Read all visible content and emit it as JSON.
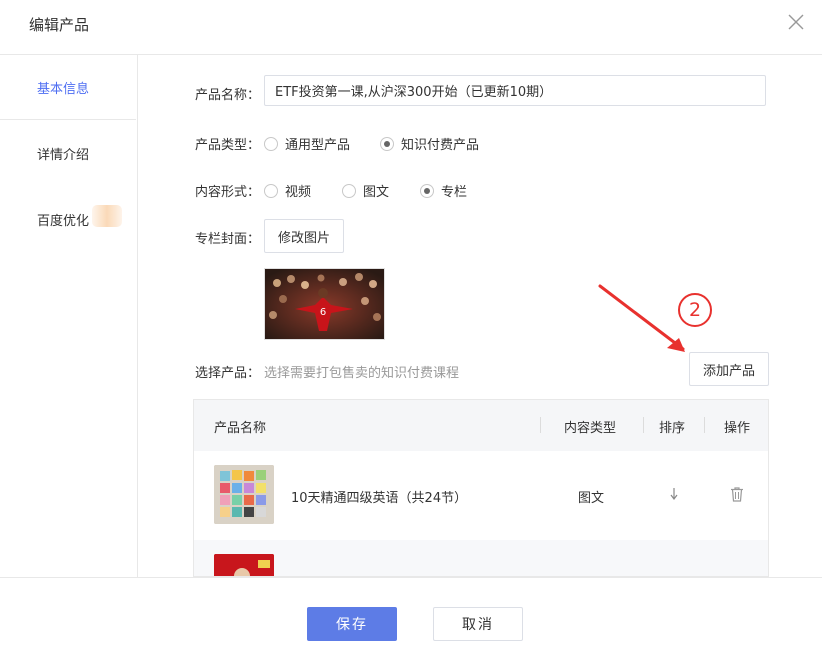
{
  "dialog": {
    "title": "编辑产品"
  },
  "sidebar": {
    "items": [
      {
        "label": "基本信息",
        "active": true
      },
      {
        "label": "详情介绍",
        "active": false
      },
      {
        "label": "百度优化",
        "active": false
      }
    ]
  },
  "form": {
    "name_label": "产品名称：",
    "name_value": "ETF投资第一课,从沪深300开始（已更新10期）",
    "type_label": "产品类型：",
    "type_options": [
      {
        "label": "通用型产品",
        "checked": false
      },
      {
        "label": "知识付费产品",
        "checked": true
      }
    ],
    "format_label": "内容形式：",
    "format_options": [
      {
        "label": "视频",
        "checked": false
      },
      {
        "label": "图文",
        "checked": false
      },
      {
        "label": "专栏",
        "checked": true
      }
    ],
    "cover_label": "专栏封面：",
    "cover_button": "修改图片",
    "select_label": "选择产品：",
    "select_hint": "选择需要打包售卖的知识付费课程",
    "add_button": "添加产品"
  },
  "table": {
    "headers": {
      "name": "产品名称",
      "type": "内容类型",
      "order": "排序",
      "action": "操作"
    },
    "rows": [
      {
        "name": "10天精通四级英语（共24节）",
        "type": "图文",
        "order_icon": "arrow-down-icon",
        "action_icon": "trash-icon"
      },
      {
        "name": "",
        "type": "",
        "order_icon": "arrow-icon",
        "action_icon": "trash-icon"
      }
    ]
  },
  "annotation": {
    "number": "2",
    "color": "#e8312e"
  },
  "footer": {
    "save_label": "保存",
    "cancel_label": "取消"
  },
  "colors": {
    "primary": "#5d7ce6",
    "active_tab": "#4e6ef2",
    "annotation": "#e8312e"
  }
}
